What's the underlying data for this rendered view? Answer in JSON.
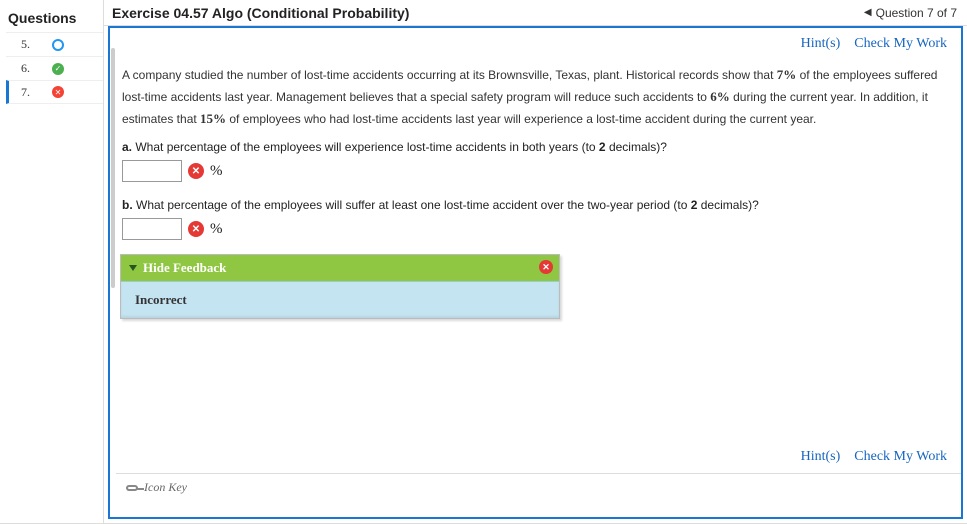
{
  "sidebar": {
    "header": "Questions",
    "items": [
      {
        "num": "5.",
        "status": "blue"
      },
      {
        "num": "6.",
        "status": "green"
      },
      {
        "num": "7.",
        "status": "red",
        "current": true
      }
    ]
  },
  "header": {
    "title": "Exercise 04.57 Algo (Conditional Probability)",
    "pager_label": "Question 7 of 7"
  },
  "toolbar": {
    "hints": "Hint(s)",
    "check": "Check My Work"
  },
  "problem": {
    "intro_1": "A company studied the number of lost-time accidents occurring at its Brownsville, Texas, plant. Historical records show that ",
    "pct1": "7%",
    "intro_2": " of the employees suffered lost-time accidents last year. Management believes that a special safety program will reduce such accidents to ",
    "pct2": "6%",
    "intro_3": " during the current year. In addition, it estimates that ",
    "pct3": "15%",
    "intro_4": " of employees who had lost-time accidents last year will experience a lost-time accident during the current year.",
    "q_a_label": "a.",
    "q_a_text": " What percentage of the employees will experience lost-time accidents in both years (to ",
    "q_a_dec": "2",
    "q_a_tail": " decimals)?",
    "q_b_label": "b.",
    "q_b_text": " What percentage of the employees will suffer at least one lost-time accident over the two-year period (to ",
    "q_b_dec": "2",
    "q_b_tail": " decimals)?",
    "unit": "%",
    "answer_a": "",
    "answer_b": ""
  },
  "feedback": {
    "toggle_label": "Hide Feedback",
    "status": "Incorrect"
  },
  "footer": {
    "icon_key": "Icon Key"
  }
}
